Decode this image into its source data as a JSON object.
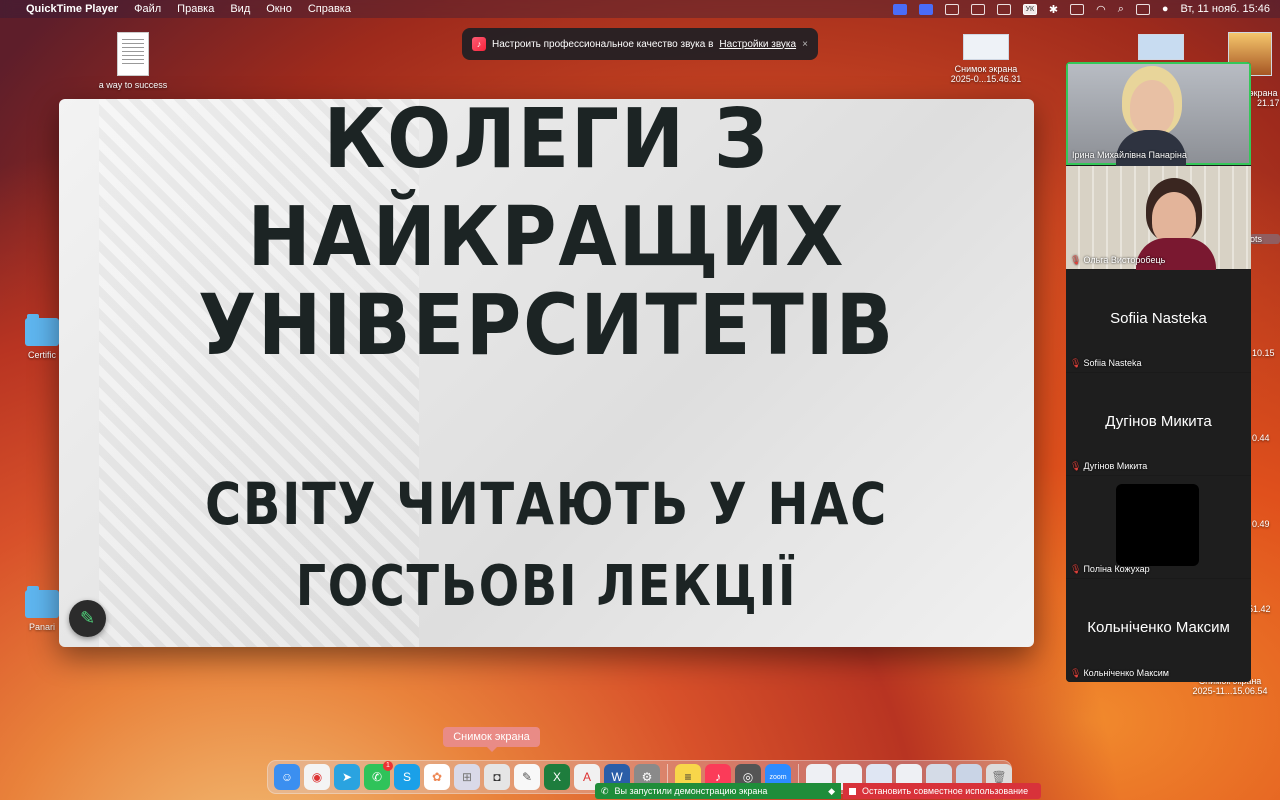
{
  "menubar": {
    "app_name": "QuickTime Player",
    "menus": [
      "Файл",
      "Правка",
      "Вид",
      "Окно",
      "Справка"
    ],
    "keyboard_layout": "УК",
    "clock": "Вт, 11 нояб.  15:46"
  },
  "desktop": {
    "doc_label": "a way to success",
    "screenshot1_label_line1": "Снимок экрана",
    "screenshot1_label_line2": "2025-0...15.46.31",
    "folder1_label": "Certific",
    "folder2_label": "Panari",
    "right_labels": [
      "экрана",
      "21.17",
      "ots",
      "10.15",
      "0.44",
      "0.49",
      "51.42"
    ],
    "screenshot2_label_line1": "Снимок экрана",
    "screenshot2_label_line2": "2025-11...15.06.54"
  },
  "banner": {
    "text": "Настроить профессиональное качество звука в",
    "link": "Настройки звука",
    "close": "×"
  },
  "slide": {
    "line1": "КОЛЕГИ З",
    "line2": "НАЙКРАЩИХ",
    "line3": "УНІВЕРСИТЕТІВ",
    "line4": "СВІТУ ЧИТАЮТЬ У НАС",
    "line5": "ГОСТЬОВІ ЛЕКЦІЇ"
  },
  "participants": [
    {
      "name": "Ірина Михайлівна Панаріна",
      "video": true
    },
    {
      "name": "Ольга Висторобець",
      "video": true
    },
    {
      "name": "Sofiia Nasteka",
      "video": false
    },
    {
      "name": "Дугінов Микита",
      "video": false
    },
    {
      "name": "Поліна Кожухар",
      "video": false
    },
    {
      "name": "Кольніченко Максим",
      "video": false
    }
  ],
  "tooltip": "Снимок экрана",
  "share_bar": "Вы запустили демонстрацию экрана",
  "stop_bar": "Остановить совместное использование",
  "dock": {
    "badge": "1",
    "zoom_label": "zoom"
  }
}
